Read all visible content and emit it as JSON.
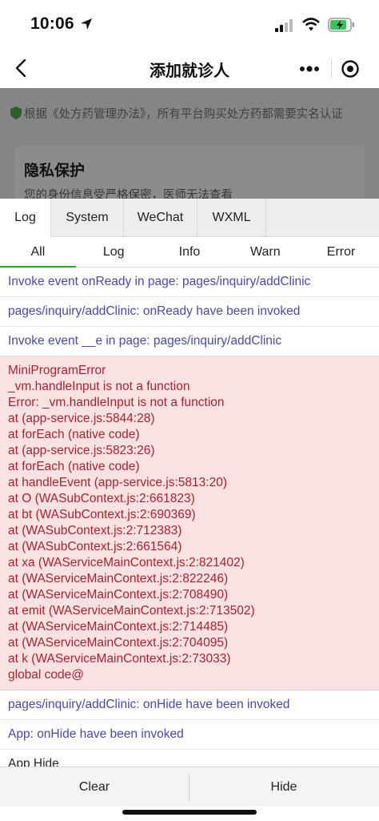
{
  "status_bar": {
    "time": "10:06",
    "icons": [
      "location-arrow-icon",
      "cellular-signal-icon",
      "wifi-icon",
      "battery-charging-icon"
    ]
  },
  "nav": {
    "title": "添加就诊人",
    "icons": [
      "back-arrow-icon",
      "more-dots-icon",
      "mini-program-close-icon"
    ]
  },
  "page": {
    "notice": "根据《处方药管理办法》，所有平台购买处方药都需要实名认证",
    "privacy_title": "隐私保护",
    "privacy_desc": "您的身份信息受严格保密，医师无法查看"
  },
  "console": {
    "tabs": [
      "Log",
      "System",
      "WeChat",
      "WXML"
    ],
    "active_tab": "Log",
    "filters": [
      "All",
      "Log",
      "Info",
      "Warn",
      "Error"
    ],
    "active_filter": "All",
    "logs": [
      "Invoke event onReady in page: pages/inquiry/addClinic",
      "pages/inquiry/addClinic: onReady have been invoked",
      "Invoke event __e in page: pages/inquiry/addClinic"
    ],
    "error_lines": [
      "MiniProgramError",
      "_vm.handleInput is not a function",
      "Error: _vm.handleInput is not a function",
      "at (app-service.js:5844:28)",
      "at forEach (native code)",
      "at (app-service.js:5823:26)",
      "at forEach (native code)",
      "at handleEvent (app-service.js:5813:20)",
      "at O (WASubContext.js:2:661823)",
      "at bt (WASubContext.js:2:690369)",
      "at (WASubContext.js:2:712383)",
      "at (WASubContext.js:2:661564)",
      "at xa (WAServiceMainContext.js:2:821402)",
      "at (WAServiceMainContext.js:2:822246)",
      "at (WAServiceMainContext.js:2:708490)",
      "at emit (WAServiceMainContext.js:2:713502)",
      "at (WAServiceMainContext.js:2:714485)",
      "at (WAServiceMainContext.js:2:704095)",
      "at k (WAServiceMainContext.js:2:73033)",
      "global code@"
    ],
    "logs_after": [
      "pages/inquiry/addClinic: onHide have been invoked",
      "App: onHide have been invoked"
    ],
    "plain_log": "App Hide",
    "clear_label": "Clear",
    "hide_label": "Hide"
  },
  "colors": {
    "info_text": "#4b48a8",
    "error_text": "#a8232e",
    "error_bg": "#fbe2e2",
    "active_filter": "#1aad19"
  }
}
